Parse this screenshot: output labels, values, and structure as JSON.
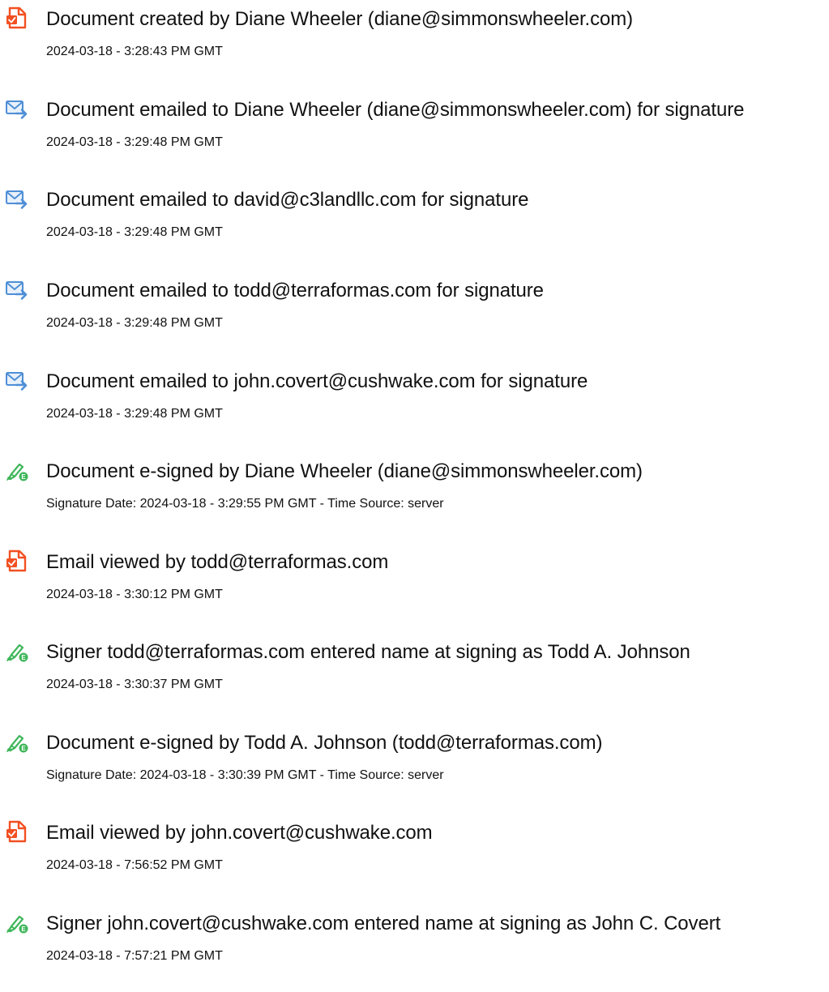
{
  "colors": {
    "doc_icon": "#f25022",
    "mail_icon": "#4f8fd6",
    "sign_icon": "#3fb65a"
  },
  "events": [
    {
      "icon": "document-icon",
      "text": "Document created by Diane Wheeler (diane@simmonswheeler.com)",
      "sub": "2024-03-18 - 3:28:43 PM GMT"
    },
    {
      "icon": "email-sent-icon",
      "text": "Document emailed to Diane Wheeler (diane@simmonswheeler.com) for signature",
      "sub": "2024-03-18 - 3:29:48 PM GMT"
    },
    {
      "icon": "email-sent-icon",
      "text": "Document emailed to david@c3landllc.com for signature",
      "sub": "2024-03-18 - 3:29:48 PM GMT"
    },
    {
      "icon": "email-sent-icon",
      "text": "Document emailed to todd@terraformas.com for signature",
      "sub": "2024-03-18 - 3:29:48 PM GMT"
    },
    {
      "icon": "email-sent-icon",
      "text": "Document emailed to john.covert@cushwake.com for signature",
      "sub": "2024-03-18 - 3:29:48 PM GMT"
    },
    {
      "icon": "e-sign-icon",
      "text": "Document e-signed by Diane Wheeler (diane@simmonswheeler.com)",
      "sub": "Signature Date: 2024-03-18 - 3:29:55 PM GMT - Time Source: server"
    },
    {
      "icon": "document-icon",
      "text": "Email viewed by todd@terraformas.com",
      "sub": "2024-03-18 - 3:30:12 PM GMT"
    },
    {
      "icon": "e-sign-icon",
      "text": "Signer todd@terraformas.com entered name at signing as Todd A. Johnson",
      "sub": "2024-03-18 - 3:30:37 PM GMT"
    },
    {
      "icon": "e-sign-icon",
      "text": "Document e-signed by Todd A. Johnson (todd@terraformas.com)",
      "sub": "Signature Date: 2024-03-18 - 3:30:39 PM GMT - Time Source: server"
    },
    {
      "icon": "document-icon",
      "text": "Email viewed by john.covert@cushwake.com",
      "sub": "2024-03-18 - 7:56:52 PM GMT"
    },
    {
      "icon": "e-sign-icon",
      "text": "Signer john.covert@cushwake.com entered name at signing as John C. Covert",
      "sub": "2024-03-18 - 7:57:21 PM GMT"
    }
  ]
}
